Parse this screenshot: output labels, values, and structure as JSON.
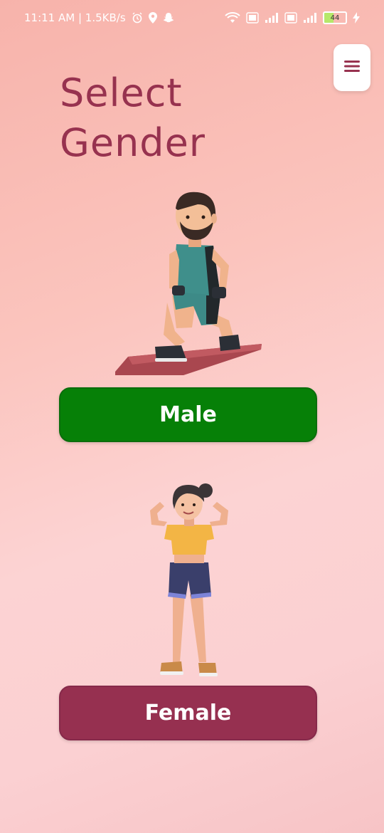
{
  "status_bar": {
    "time_speed": "11:11 AM | 1.5KB/s",
    "battery": "44",
    "icons": [
      "alarm-icon",
      "location-icon",
      "snapchat-icon",
      "wifi-icon",
      "volte-icon",
      "signal-icon",
      "battery-icon",
      "charging-icon"
    ]
  },
  "header": {
    "title_line1": "Select",
    "title_line2": "Gender",
    "menu_icon": "hamburger-menu-icon"
  },
  "options": {
    "male_label": "Male",
    "female_label": "Female"
  },
  "colors": {
    "title": "#97324f",
    "male_button": "#068007",
    "female_button": "#963050",
    "background_top": "#f7b3ab",
    "background_bottom": "#fbd0d2"
  }
}
